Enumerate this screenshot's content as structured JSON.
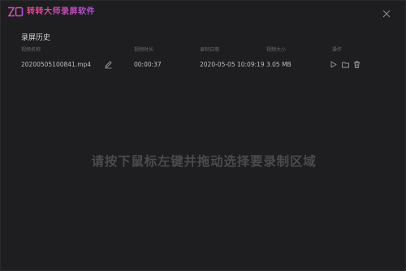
{
  "app": {
    "title": "转转大师录屏软件"
  },
  "history": {
    "section_title": "录屏历史",
    "columns": [
      "视频名称",
      "视频时长",
      "录制日期",
      "视频大小",
      "操作"
    ],
    "rows": [
      {
        "name": "20200505100841.mp4",
        "duration": "00:00:37",
        "date": "2020-05-05 10:09:19",
        "size": "3.05 MB"
      }
    ]
  },
  "hint": "请按下鼠标左键并拖动选择要录制区域",
  "icons": {
    "logo": "app-logo-icon",
    "close": "close-icon",
    "rename": "edit-icon",
    "play": "play-icon",
    "open_folder": "folder-icon",
    "delete": "trash-icon"
  },
  "colors": {
    "background": "#1e1e20",
    "brand_start": "#e24b8c",
    "brand_end": "#b54ee0",
    "hint_text": "#4b4b4f"
  }
}
